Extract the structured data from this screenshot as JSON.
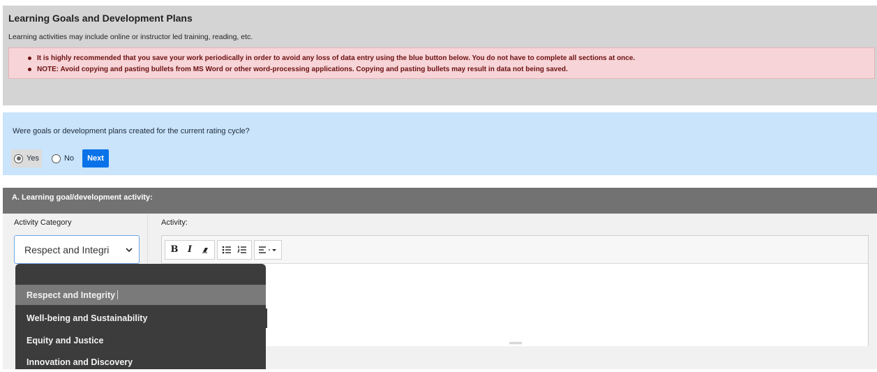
{
  "header": {
    "title": "Learning Goals and Development Plans",
    "subtitle": "Learning activities may include online or instructor led training, reading, etc.",
    "notices": [
      "It is highly recommended that you save your work periodically in order to avoid any loss of data entry using the blue button below. You do not have to complete all sections at once.",
      "NOTE: Avoid copying and pasting bullets from MS Word or other word-processing applications. Copying and pasting bullets may result in data not being saved."
    ]
  },
  "question": {
    "text": "Were goals or development plans created for the current rating cycle?",
    "yes_label": "Yes",
    "no_label": "No",
    "selected": "Yes",
    "next_label": "Next"
  },
  "section": {
    "title": "A. Learning goal/development activity:",
    "category_label": "Activity Category",
    "category_value": "Respect and Integri",
    "activity_label": "Activity:"
  },
  "toolbar": {
    "bold": "B",
    "italic": "I"
  },
  "dropdown": {
    "options": [
      "Respect and Integrity",
      "Well-being and Sustainability",
      "Equity and Justice",
      "Innovation and Discovery"
    ],
    "highlighted": "Respect and Integrity"
  },
  "colors": {
    "notice_bg": "#f7d4d7",
    "notice_text": "#6b1010",
    "question_bg": "#c9e4fb",
    "accent": "#0a72e8",
    "section_header": "#727272",
    "dropdown_bg": "#3c3c3c",
    "dropdown_highlight": "#7a7a7a"
  }
}
